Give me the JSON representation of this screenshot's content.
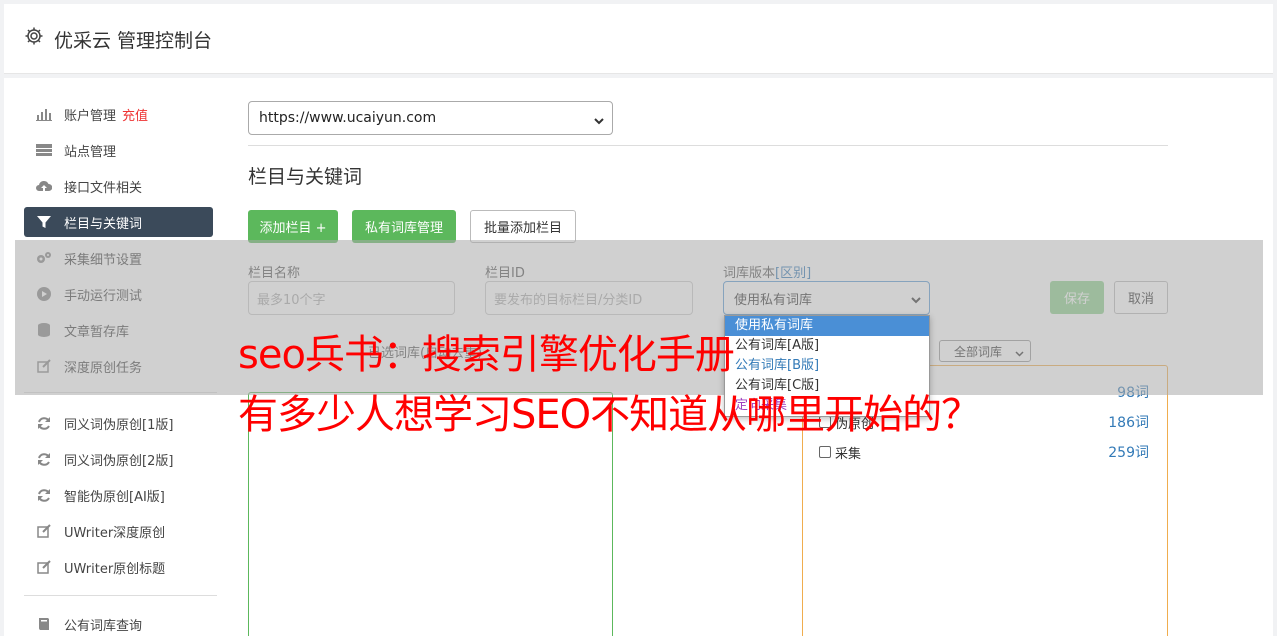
{
  "header": {
    "title": "优采云 管理控制台"
  },
  "sidebar": {
    "items": [
      {
        "label": "账户管理",
        "extra": "充值",
        "icon": "bar-chart-icon"
      },
      {
        "label": "站点管理",
        "icon": "server-icon"
      },
      {
        "label": "接口文件相关",
        "icon": "cloud-upload-icon"
      },
      {
        "label": "栏目与关键词",
        "icon": "filter-icon",
        "active": true
      },
      {
        "label": "采集细节设置",
        "icon": "cogs-icon"
      },
      {
        "label": "手动运行测试",
        "icon": "play-circle-icon"
      },
      {
        "label": "文章暂存库",
        "icon": "database-icon"
      },
      {
        "label": "深度原创任务",
        "icon": "edit-icon"
      },
      {
        "label": "同义词伪原创[1版]",
        "icon": "refresh-icon"
      },
      {
        "label": "同义词伪原创[2版]",
        "icon": "refresh-icon"
      },
      {
        "label": "智能伪原创[AI版]",
        "icon": "refresh-icon"
      },
      {
        "label": "UWriter深度原创",
        "icon": "edit-icon"
      },
      {
        "label": "UWriter原创标题",
        "icon": "edit-icon"
      },
      {
        "label": "公有词库查询",
        "icon": "book-icon"
      }
    ]
  },
  "site_select": {
    "value": "https://www.ucaiyun.com"
  },
  "section_title": "栏目与关键词",
  "buttons": {
    "add_column": "添加栏目 +",
    "private_lib": "私有词库管理",
    "batch_add": "批量添加栏目",
    "save": "保存",
    "cancel": "取消"
  },
  "form": {
    "name_label": "栏目名称",
    "name_placeholder": "最多10个字",
    "id_label": "栏目ID",
    "id_placeholder": "要发布的目标栏目/分类ID",
    "lib_label": "词库版本",
    "lib_label_link": "[区别]",
    "lib_value": "使用私有词库",
    "lib_options": [
      "使用私有词库",
      "公有词库[A版]",
      "公有词库[B版]",
      "公有词库[C版]",
      "定向采集"
    ],
    "sub_label": "已选词库(自动去重)",
    "filter_value": "全部词库"
  },
  "libraries": [
    {
      "name": "",
      "count": "98词"
    },
    {
      "name": "伪原创",
      "count": "186词"
    },
    {
      "name": "采集",
      "count": "259词"
    }
  ],
  "banner": {
    "line1": "seo兵书：搜索引擎优化手册",
    "line2": "有多少人想学习SEO不知道从哪里开始的？"
  },
  "colors": {
    "accent_green": "#5cb85c",
    "banner_red": "#ff0000",
    "active_nav": "#3b4a5a"
  }
}
